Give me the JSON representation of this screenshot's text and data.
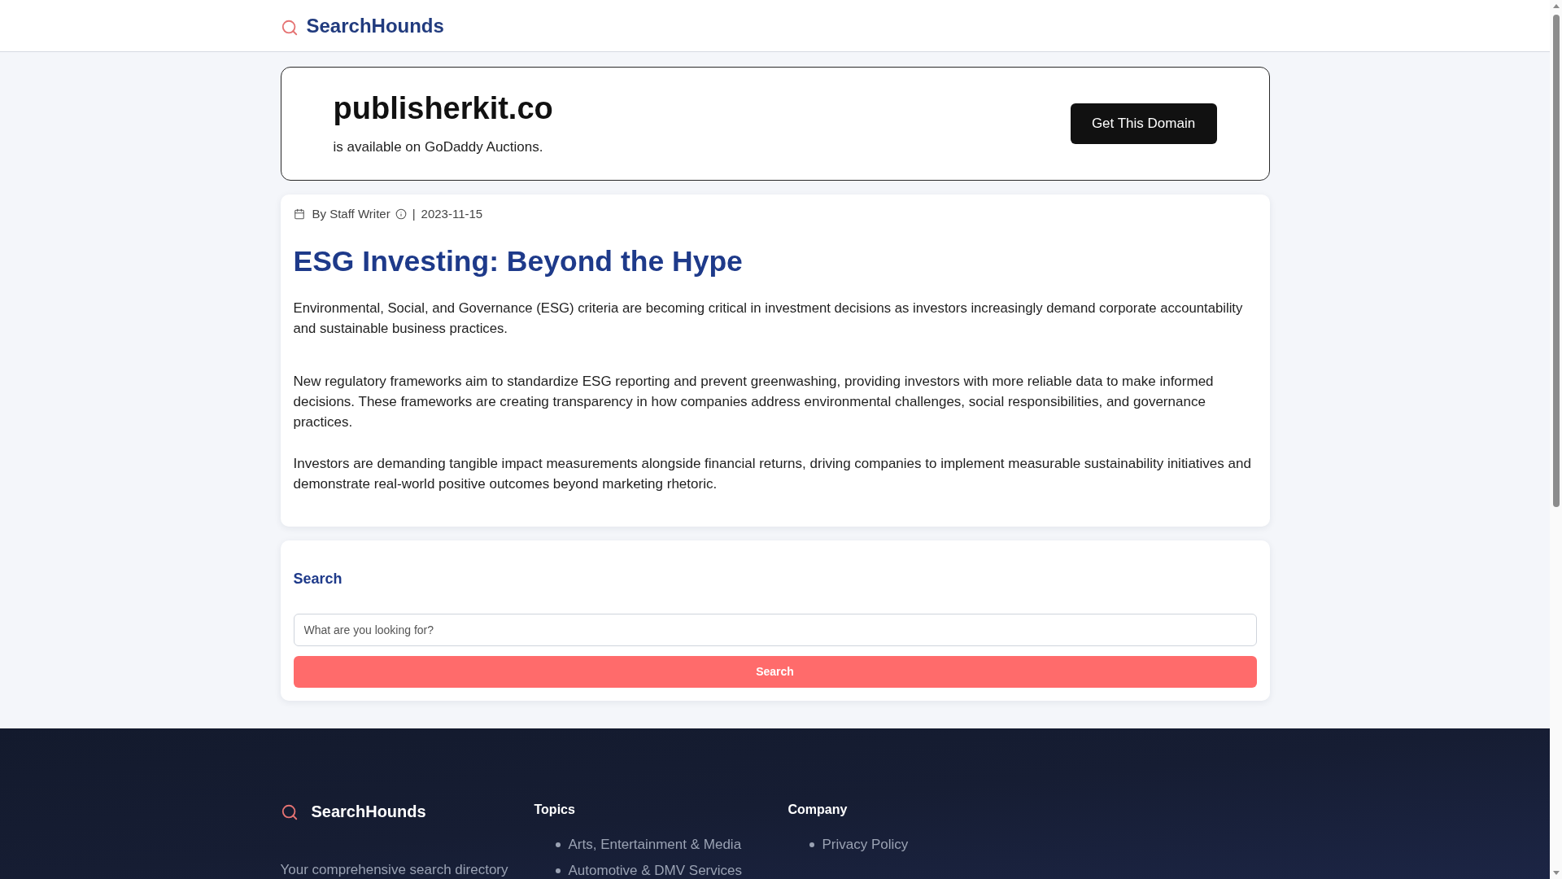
{
  "header": {
    "logo_text": "SearchHounds"
  },
  "domain_banner": {
    "domain": "publisherkit.co",
    "subtitle": "is available on GoDaddy Auctions.",
    "button": "Get This Domain"
  },
  "article": {
    "meta": {
      "author": "By Staff Writer",
      "separator": "|",
      "date": "2023-11-15"
    },
    "title": "ESG Investing: Beyond the Hype",
    "summary": "Environmental, Social, and Governance (ESG) criteria are becoming critical in investment decisions as investors increasingly demand corporate accountability and sustainable business practices.",
    "paragraphs": [
      "New regulatory frameworks aim to standardize ESG reporting and prevent greenwashing, providing investors with more reliable data to make informed decisions. These frameworks are creating transparency in how companies address environmental challenges, social responsibilities, and governance practices.",
      "Investors are demanding tangible impact measurements alongside financial returns, driving companies to implement measurable sustainability initiatives and demonstrate real-world positive outcomes beyond marketing rhetoric."
    ]
  },
  "search": {
    "heading": "Search",
    "placeholder": "What are you looking for?",
    "button": "Search"
  },
  "footer": {
    "logo_text": "SearchHounds",
    "tagline": "Your comprehensive search directory",
    "columns": [
      {
        "heading": "Topics",
        "links": [
          "Arts, Entertainment & Media",
          "Automotive & DMV Services"
        ]
      },
      {
        "heading": "Company",
        "links": [
          "Privacy Policy"
        ]
      }
    ]
  }
}
